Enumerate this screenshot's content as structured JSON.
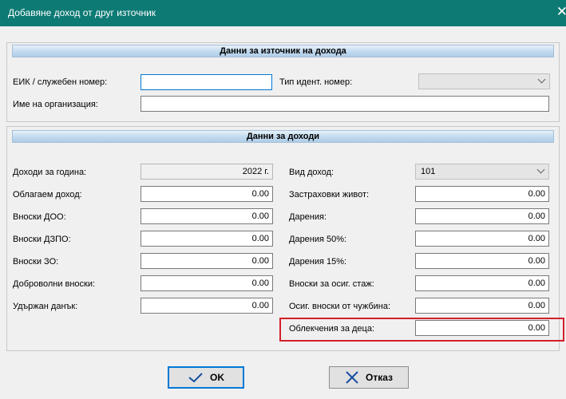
{
  "window": {
    "title": "Добавяне доход от друг източник",
    "close_glyph": "✕"
  },
  "source_section": {
    "header": "Данни за източник на дохода",
    "eik_label": "ЕИК / служебен номер:",
    "eik_value": "",
    "id_type_label": "Тип идент. номер:",
    "id_type_value": "",
    "org_name_label": "Име на организация:",
    "org_name_value": ""
  },
  "income_section": {
    "header": "Данни за доходи",
    "left": [
      {
        "label": "Доходи за година:",
        "value": "2022 г."
      },
      {
        "label": "Облагаем доход:",
        "value": "0.00"
      },
      {
        "label": "Вноски ДОО:",
        "value": "0.00"
      },
      {
        "label": "Вноски ДЗПО:",
        "value": "0.00"
      },
      {
        "label": "Вноски ЗО:",
        "value": "0.00"
      },
      {
        "label": "Доброволни вноски:",
        "value": "0.00"
      },
      {
        "label": "Удържан данък:",
        "value": "0.00"
      }
    ],
    "income_type_label": "Вид доход:",
    "income_type_value": "101",
    "right": [
      {
        "label": "Застраховки живот:",
        "value": "0.00"
      },
      {
        "label": "Дарения:",
        "value": "0.00"
      },
      {
        "label": "Дарения 50%:",
        "value": "0.00"
      },
      {
        "label": "Дарения 15%:",
        "value": "0.00"
      },
      {
        "label": "Вноски за осиг. стаж:",
        "value": "0.00"
      },
      {
        "label": "Осиг. вноски от чужбина:",
        "value": "0.00"
      },
      {
        "label": "Облекчения за деца:",
        "value": "0.00"
      }
    ]
  },
  "buttons": {
    "ok_label": "OK",
    "cancel_label": "Отказ"
  },
  "icons": {
    "ok": "checkmark-icon",
    "cancel": "x-icon",
    "dropdown": "chevron-down-icon",
    "close": "close-icon"
  },
  "colors": {
    "titlebar": "#0d7a74",
    "highlight": "#d41f2a",
    "focus": "#0078d7"
  }
}
